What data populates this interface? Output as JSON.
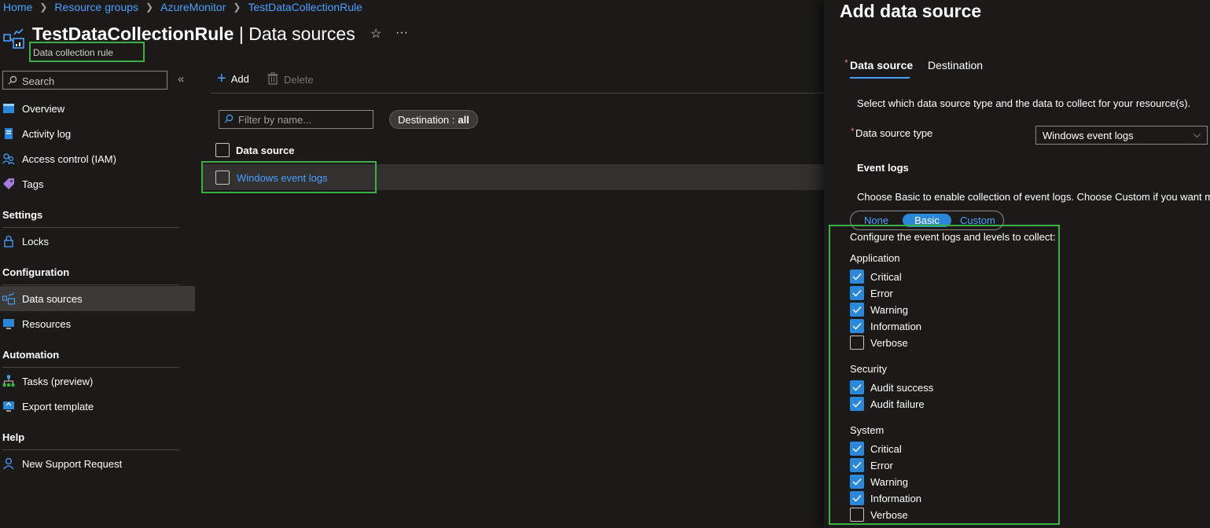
{
  "breadcrumb": [
    "Home",
    "Resource groups",
    "AzureMonitor",
    "TestDataCollectionRule"
  ],
  "header": {
    "title_bold": "TestDataCollectionRule",
    "title_rest": " | Data sources",
    "subtitle": "Data collection rule"
  },
  "sidebar": {
    "search_placeholder": "Search",
    "items": [
      {
        "label": "Overview"
      },
      {
        "label": "Activity log"
      },
      {
        "label": "Access control (IAM)"
      },
      {
        "label": "Tags"
      }
    ],
    "sections": {
      "settings": "Settings",
      "configuration": "Configuration",
      "automation": "Automation",
      "help": "Help"
    },
    "settings_items": [
      {
        "label": "Locks"
      }
    ],
    "configuration_items": [
      {
        "label": "Data sources"
      },
      {
        "label": "Resources"
      }
    ],
    "automation_items": [
      {
        "label": "Tasks (preview)"
      },
      {
        "label": "Export template"
      }
    ],
    "help_items": [
      {
        "label": "New Support Request"
      }
    ]
  },
  "toolbar": {
    "add": "Add",
    "delete": "Delete"
  },
  "filter": {
    "placeholder": "Filter by name...",
    "pill_label": "Destination :",
    "pill_value": "all"
  },
  "table": {
    "header": "Data source",
    "rows": [
      {
        "name": "Windows event logs"
      }
    ]
  },
  "panel": {
    "title": "Add data source",
    "tabs": [
      "Data source",
      "Destination"
    ],
    "description": "Select which data source type and the data to collect for your resource(s).",
    "type_label": "Data source type",
    "type_value": "Windows event logs",
    "event_logs_title": "Event logs",
    "event_logs_desc": "Choose Basic to enable collection of event logs. Choose Custom if you want m",
    "segments": [
      "None",
      "Basic",
      "Custom"
    ],
    "configure_title": "Configure the event logs and levels to collect:",
    "groups": [
      {
        "name": "Application",
        "items": [
          {
            "label": "Critical",
            "checked": true
          },
          {
            "label": "Error",
            "checked": true
          },
          {
            "label": "Warning",
            "checked": true
          },
          {
            "label": "Information",
            "checked": true
          },
          {
            "label": "Verbose",
            "checked": false
          }
        ]
      },
      {
        "name": "Security",
        "items": [
          {
            "label": "Audit success",
            "checked": true
          },
          {
            "label": "Audit failure",
            "checked": true
          }
        ]
      },
      {
        "name": "System",
        "items": [
          {
            "label": "Critical",
            "checked": true
          },
          {
            "label": "Error",
            "checked": true
          },
          {
            "label": "Warning",
            "checked": true
          },
          {
            "label": "Information",
            "checked": true
          },
          {
            "label": "Verbose",
            "checked": false
          }
        ]
      }
    ]
  },
  "colors": {
    "accent": "#4aa0ff",
    "check": "#2b88d8",
    "highlight": "#3cb043"
  }
}
